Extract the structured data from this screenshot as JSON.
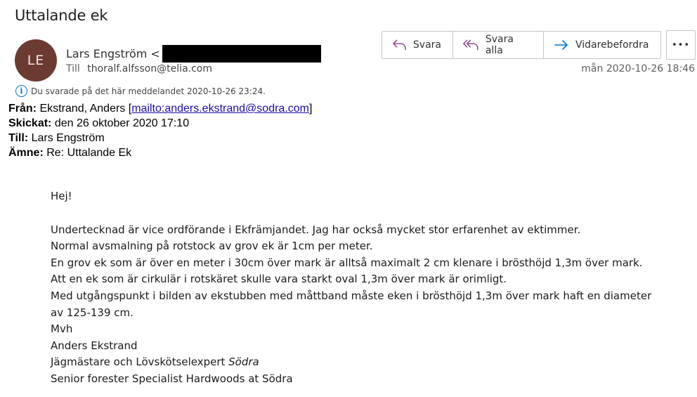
{
  "subject": "Uttalande ek",
  "sender": {
    "initials": "LE",
    "name": "Lars Engström <",
    "to_label": "Till",
    "to_value": "thoralf.alfsson@telia.com"
  },
  "actions": {
    "reply": "Svara",
    "reply_all": "Svara alla",
    "forward": "Vidarebefordra",
    "more": "•••"
  },
  "date": "mån 2020-10-26 18:46",
  "notice": "Du svarade på det här meddelandet 2020-10-26 23:24.",
  "quoted": {
    "from_label": "Från:",
    "from_value": " Ekstrand, Anders [",
    "from_link": "mailto:anders.ekstrand@sodra.com",
    "from_end": "]",
    "sent_label": "Skickat:",
    "sent_value": " den 26 oktober 2020 17:10",
    "to_label": "Till:",
    "to_value": " Lars Engström",
    "subject_label": "Ämne:",
    "subject_value": " Re: Uttalande Ek"
  },
  "body": {
    "greeting": "Hej!",
    "lines": [
      "Undertecknad är vice ordförande i Ekfrämjandet. Jag har också mycket stor erfarenhet av ektimmer.",
      "Normal avsmalning på rotstock av grov ek är 1cm per meter.",
      "En grov ek som är över en meter i 30cm över mark är alltså maximalt 2 cm klenare i brösthöjd 1,3m över mark.",
      "Att en ek som är cirkulär i rotskäret skulle vara starkt oval 1,3m över mark är orimligt.",
      "Med utgångspunkt i bilden av ekstubben med måttband måste eken i brösthöjd 1,3m över mark haft en diameter",
      "av 125-139 cm."
    ],
    "closing": "Mvh",
    "signature_name": "Anders Ekstrand",
    "signature_title": "Jägmästare och Lövskötselexpert ",
    "signature_org": "Södra",
    "signature_en": "Senior forester Specialist Hardwoods at Södra"
  },
  "colors": {
    "avatar_bg": "#6b3a31",
    "accent": "#0078d4",
    "reply_icon": "#8b4b8b",
    "forward_icon": "#0078d4"
  }
}
